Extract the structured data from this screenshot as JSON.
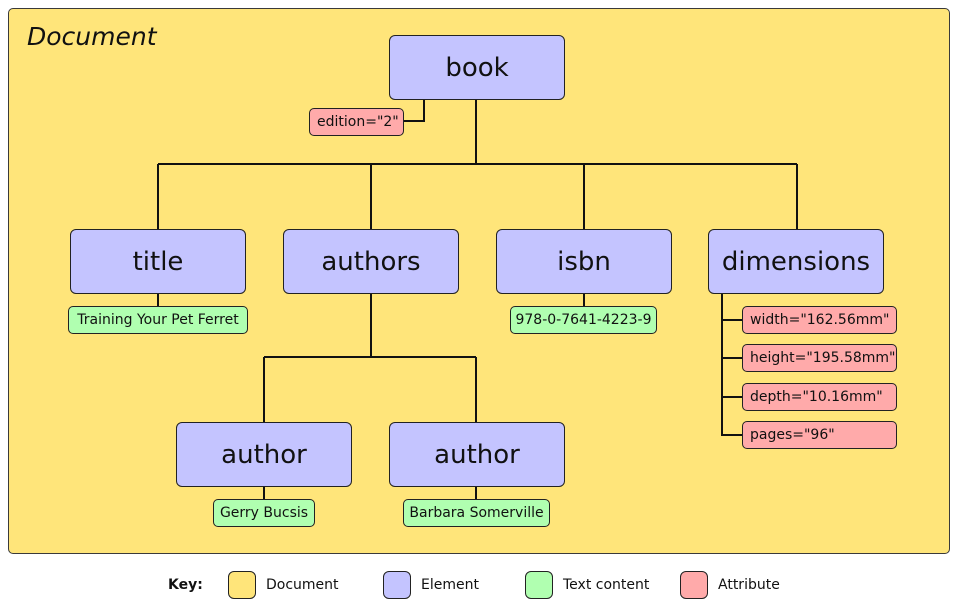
{
  "document_label": "Document",
  "colors": {
    "document": "#ffe57a",
    "element": "#c4c4ff",
    "text_content": "#b0ffb0",
    "attribute": "#ffaaaa"
  },
  "nodes": {
    "book": "book",
    "book_attr": "edition=\"2\"",
    "title": "title",
    "title_text": "Training Your Pet Ferret",
    "authors": "authors",
    "isbn": "isbn",
    "isbn_text": "978-0-7641-4223-9",
    "dimensions": "dimensions",
    "dimensions_attrs": [
      "width=\"162.56mm\"",
      "height=\"195.58mm\"",
      "depth=\"10.16mm\"",
      "pages=\"96\""
    ],
    "author1": "author",
    "author1_text": "Gerry Bucsis",
    "author2": "author",
    "author2_text": "Barbara Somerville"
  },
  "key": {
    "title": "Key:",
    "items": [
      "Document",
      "Element",
      "Text content",
      "Attribute"
    ]
  }
}
